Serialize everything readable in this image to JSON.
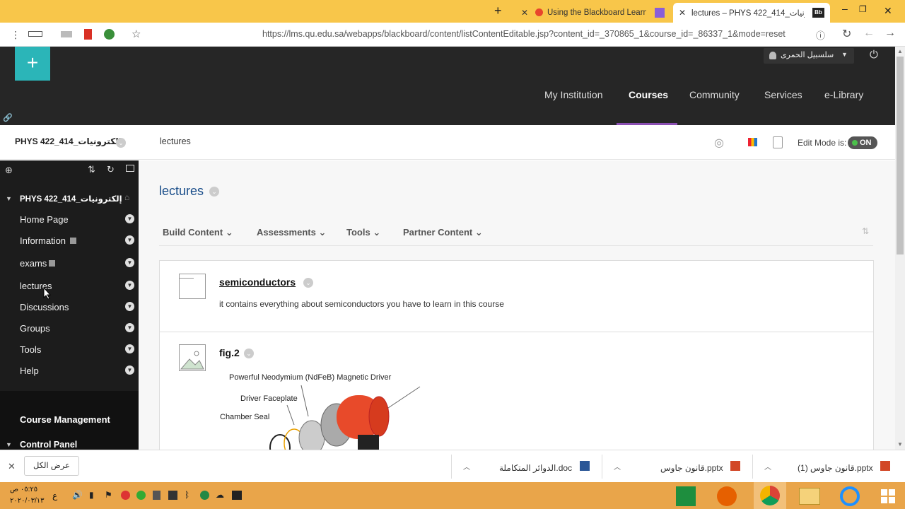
{
  "browser": {
    "tabs": [
      {
        "title": "lectures – PHYS 422_414_إلكترونيات",
        "icon": "Bb",
        "active": true
      },
      {
        "title": "Using the Blackboard Learni",
        "active": false
      }
    ],
    "url": "https://lms.qu.edu.sa/webapps/blackboard/content/listContentEditable.jsp?content_id=_370865_1&course_id=_86337_1&mode=reset"
  },
  "header": {
    "user": "سلسبيل الحمرى",
    "nav": [
      "My Institution",
      "Courses",
      "Community",
      "Services",
      "e-Library"
    ],
    "active_nav": "Courses"
  },
  "breadcrumb": {
    "course": "PHYS 422_414_إلكترونيات",
    "page": "lectures"
  },
  "edit_mode": {
    "label": "Edit Mode is:",
    "state": "ON"
  },
  "sidebar": {
    "course_title": "PHYS 422_414_إلكترونيات",
    "items": [
      {
        "label": "Home Page"
      },
      {
        "label": "Information"
      },
      {
        "label": "exams"
      },
      {
        "label": "lectures"
      },
      {
        "label": "Discussions"
      },
      {
        "label": "Groups"
      },
      {
        "label": "Tools"
      },
      {
        "label": "Help"
      }
    ],
    "course_management": "Course Management",
    "control_panel": "Control Panel"
  },
  "content": {
    "title": "lectures",
    "actions": [
      "Build Content",
      "Assessments",
      "Tools",
      "Partner Content"
    ],
    "items": [
      {
        "title": "semiconductors",
        "description": "it contains everything about semiconductors you have to learn in this course"
      },
      {
        "title": "fig.2",
        "labels": [
          "Powerful Neodymium (NdFeB) Magnetic Driver",
          "Driver Faceplate",
          "Chamber Seal"
        ]
      }
    ]
  },
  "downloads": {
    "show_all": "عرض الكل",
    "files": [
      "الدوائر المتكاملة.doc",
      "قانون جاوس.pptx",
      "قانون جاوس (1).pptx"
    ]
  },
  "taskbar": {
    "time": "٠٥:٢٥ ص",
    "date": "٢٠٢٠/٠٣/١٣"
  }
}
